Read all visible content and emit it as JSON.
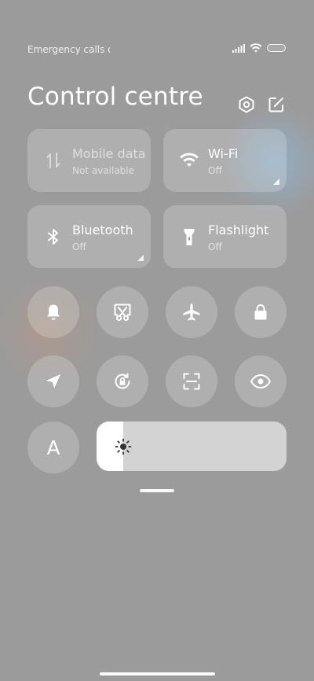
{
  "status_bar": {
    "carrier_text": "Emergency calls only",
    "icons": [
      "signal-icon",
      "wifi-icon",
      "battery-icon"
    ]
  },
  "header": {
    "title": "Control centre",
    "settings_icon": "settings-icon",
    "edit_icon": "edit-icon"
  },
  "tiles": {
    "mobile_data": {
      "label": "Mobile data",
      "status": "Not available",
      "icon": "mobile-data-icon"
    },
    "wifi": {
      "label": "Wi-Fi",
      "status": "Off",
      "icon": "wifi-icon"
    },
    "bluetooth": {
      "label": "Bluetooth",
      "status": "Off",
      "icon": "bluetooth-icon"
    },
    "flashlight": {
      "label": "Flashlight",
      "status": "Off",
      "icon": "flashlight-icon"
    }
  },
  "toggles": [
    {
      "icon": "bell-icon"
    },
    {
      "icon": "screenshot-icon"
    },
    {
      "icon": "airplane-icon"
    },
    {
      "icon": "lock-icon"
    },
    {
      "icon": "location-icon"
    },
    {
      "icon": "rotation-lock-icon"
    },
    {
      "icon": "scanner-icon"
    },
    {
      "icon": "eye-icon"
    }
  ],
  "auto_brightness": {
    "label": "A"
  },
  "brightness": {
    "level_fraction": 0.14,
    "icon": "sun-icon"
  },
  "colors": {
    "background": "#9b9b9b",
    "tile": "rgba(255,255,255,0.2)",
    "slider_track": "#d3d3d3",
    "slider_fill": "#ffffff"
  }
}
